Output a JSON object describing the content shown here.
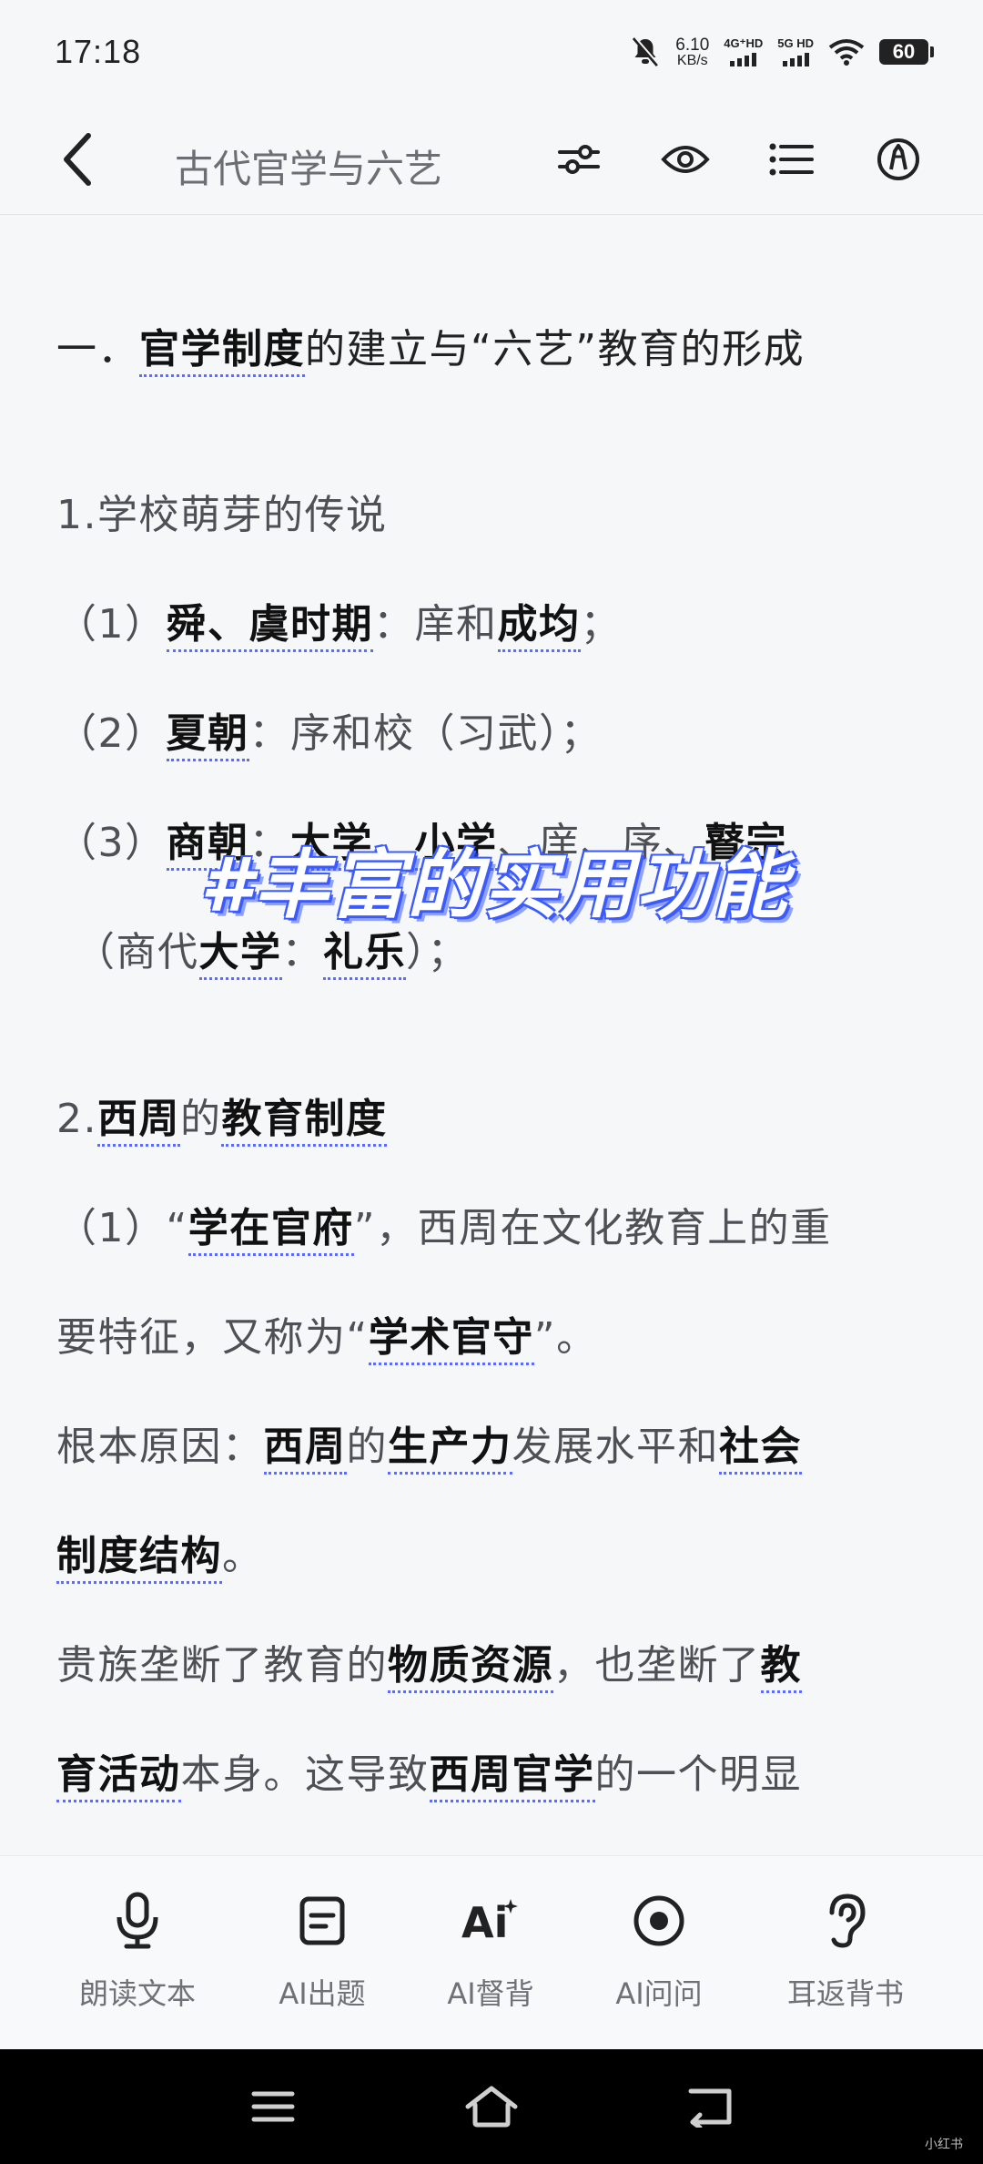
{
  "status_bar": {
    "time": "17:18",
    "speed_value": "6.10",
    "speed_unit": "KB/s",
    "net1": "4G⁺HD",
    "net2": "5G HD",
    "battery": "60"
  },
  "header": {
    "title": "古代官学与六艺",
    "icons": [
      "back-icon",
      "settings-sliders-icon",
      "eye-icon",
      "list-icon",
      "highlighter-icon"
    ]
  },
  "overlay_tag": "#丰富的实用功能",
  "content": {
    "section_title": {
      "prefix": "一．",
      "kw1": "官学制度",
      "rest": "的建立与“六艺”教育的形成"
    },
    "sub1": "1.学校萌芽的传说",
    "item1": {
      "num": "（1）",
      "kw1": "舜、虞时期",
      "t1": "：庠和",
      "kw2": "成均",
      "t2": "；"
    },
    "item2": {
      "num": "（2）",
      "kw1": "夏朝",
      "t1": "：序和校（习武）；"
    },
    "item3": {
      "num": "（3）",
      "kw1": "商朝",
      "t1": "：",
      "kw2": "大学",
      "t2": "、",
      "kw3": "小学",
      "t3": "、庠、序、",
      "kw4": "瞽宗"
    },
    "item3b": {
      "t1": "（商代",
      "kw1": "大学",
      "t2": "：",
      "kw2": "礼乐",
      "t3": "）；"
    },
    "sub2": {
      "prefix": "2.",
      "kw1": "西周",
      "t1": "的",
      "kw2": "教育制度"
    },
    "p1a": {
      "t1": "（1）“",
      "kw1": "学在官府",
      "t2": "”，西周在文化教育上的重"
    },
    "p1b": {
      "t1": "要特征，又称为“",
      "kw1": "学术官守",
      "t2": "”。"
    },
    "p2a": {
      "t1": "根本原因：",
      "kw1": "西周",
      "t2": "的",
      "kw2": "生产力",
      "t3": "发展水平和",
      "kw3": "社会"
    },
    "p2b": {
      "kw1": "制度结构",
      "t1": "。"
    },
    "p3a": {
      "t1": "贵族垄断了教育的",
      "kw1": "物质资源",
      "t2": "，也垄断了",
      "kw2": "教"
    },
    "p3b": {
      "kw1": "育活动",
      "t1": "本身。这导致",
      "kw2": "西周官学",
      "t2": "的一个明显"
    }
  },
  "toolbar": {
    "items": [
      {
        "label": "朗读文本",
        "icon": "microphone-icon"
      },
      {
        "label": "AI出题",
        "icon": "document-icon"
      },
      {
        "label": "AI督背",
        "icon": "ai-icon"
      },
      {
        "label": "AI问问",
        "icon": "record-icon"
      },
      {
        "label": "耳返背书",
        "icon": "ear-icon"
      }
    ]
  },
  "navbar": {
    "icons": [
      "menu-icon",
      "home-icon",
      "return-icon"
    ]
  },
  "watermark": "小红书"
}
